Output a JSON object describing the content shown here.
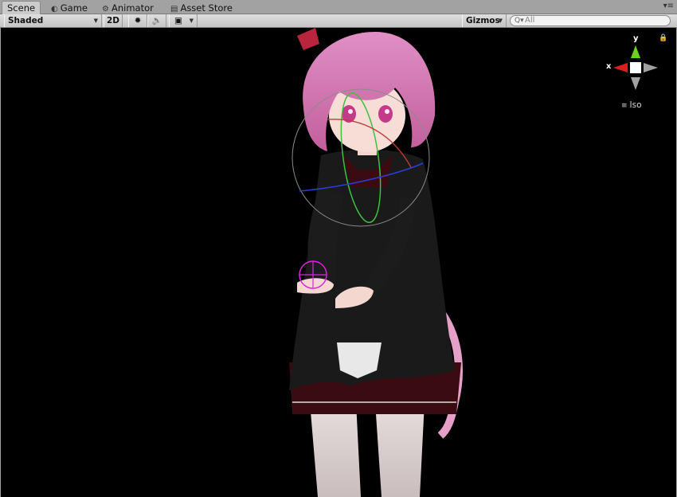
{
  "tabs": [
    {
      "label": "Scene",
      "icon": "scene-icon",
      "glyph": ""
    },
    {
      "label": "Game",
      "icon": "game-icon",
      "glyph": "◐"
    },
    {
      "label": "Animator",
      "icon": "animator-icon",
      "glyph": "⚙"
    },
    {
      "label": "Asset Store",
      "icon": "asset-store-icon",
      "glyph": "▤"
    }
  ],
  "panel_menu": "▾≡",
  "toolbar": {
    "draw_mode": "Shaded",
    "mode_2d": "2D",
    "light_glyph": "✹",
    "audio_glyph": "🔈",
    "effects_glyph": "▣",
    "gizmos_label": "Gizmos",
    "search_placeholder": "All"
  },
  "scene_gizmo": {
    "x_label": "x",
    "y_label": "y",
    "projection_label": "Iso",
    "colors": {
      "x": "#d82020",
      "y": "#6ad21e",
      "neutral": "#a0a0a0"
    }
  }
}
